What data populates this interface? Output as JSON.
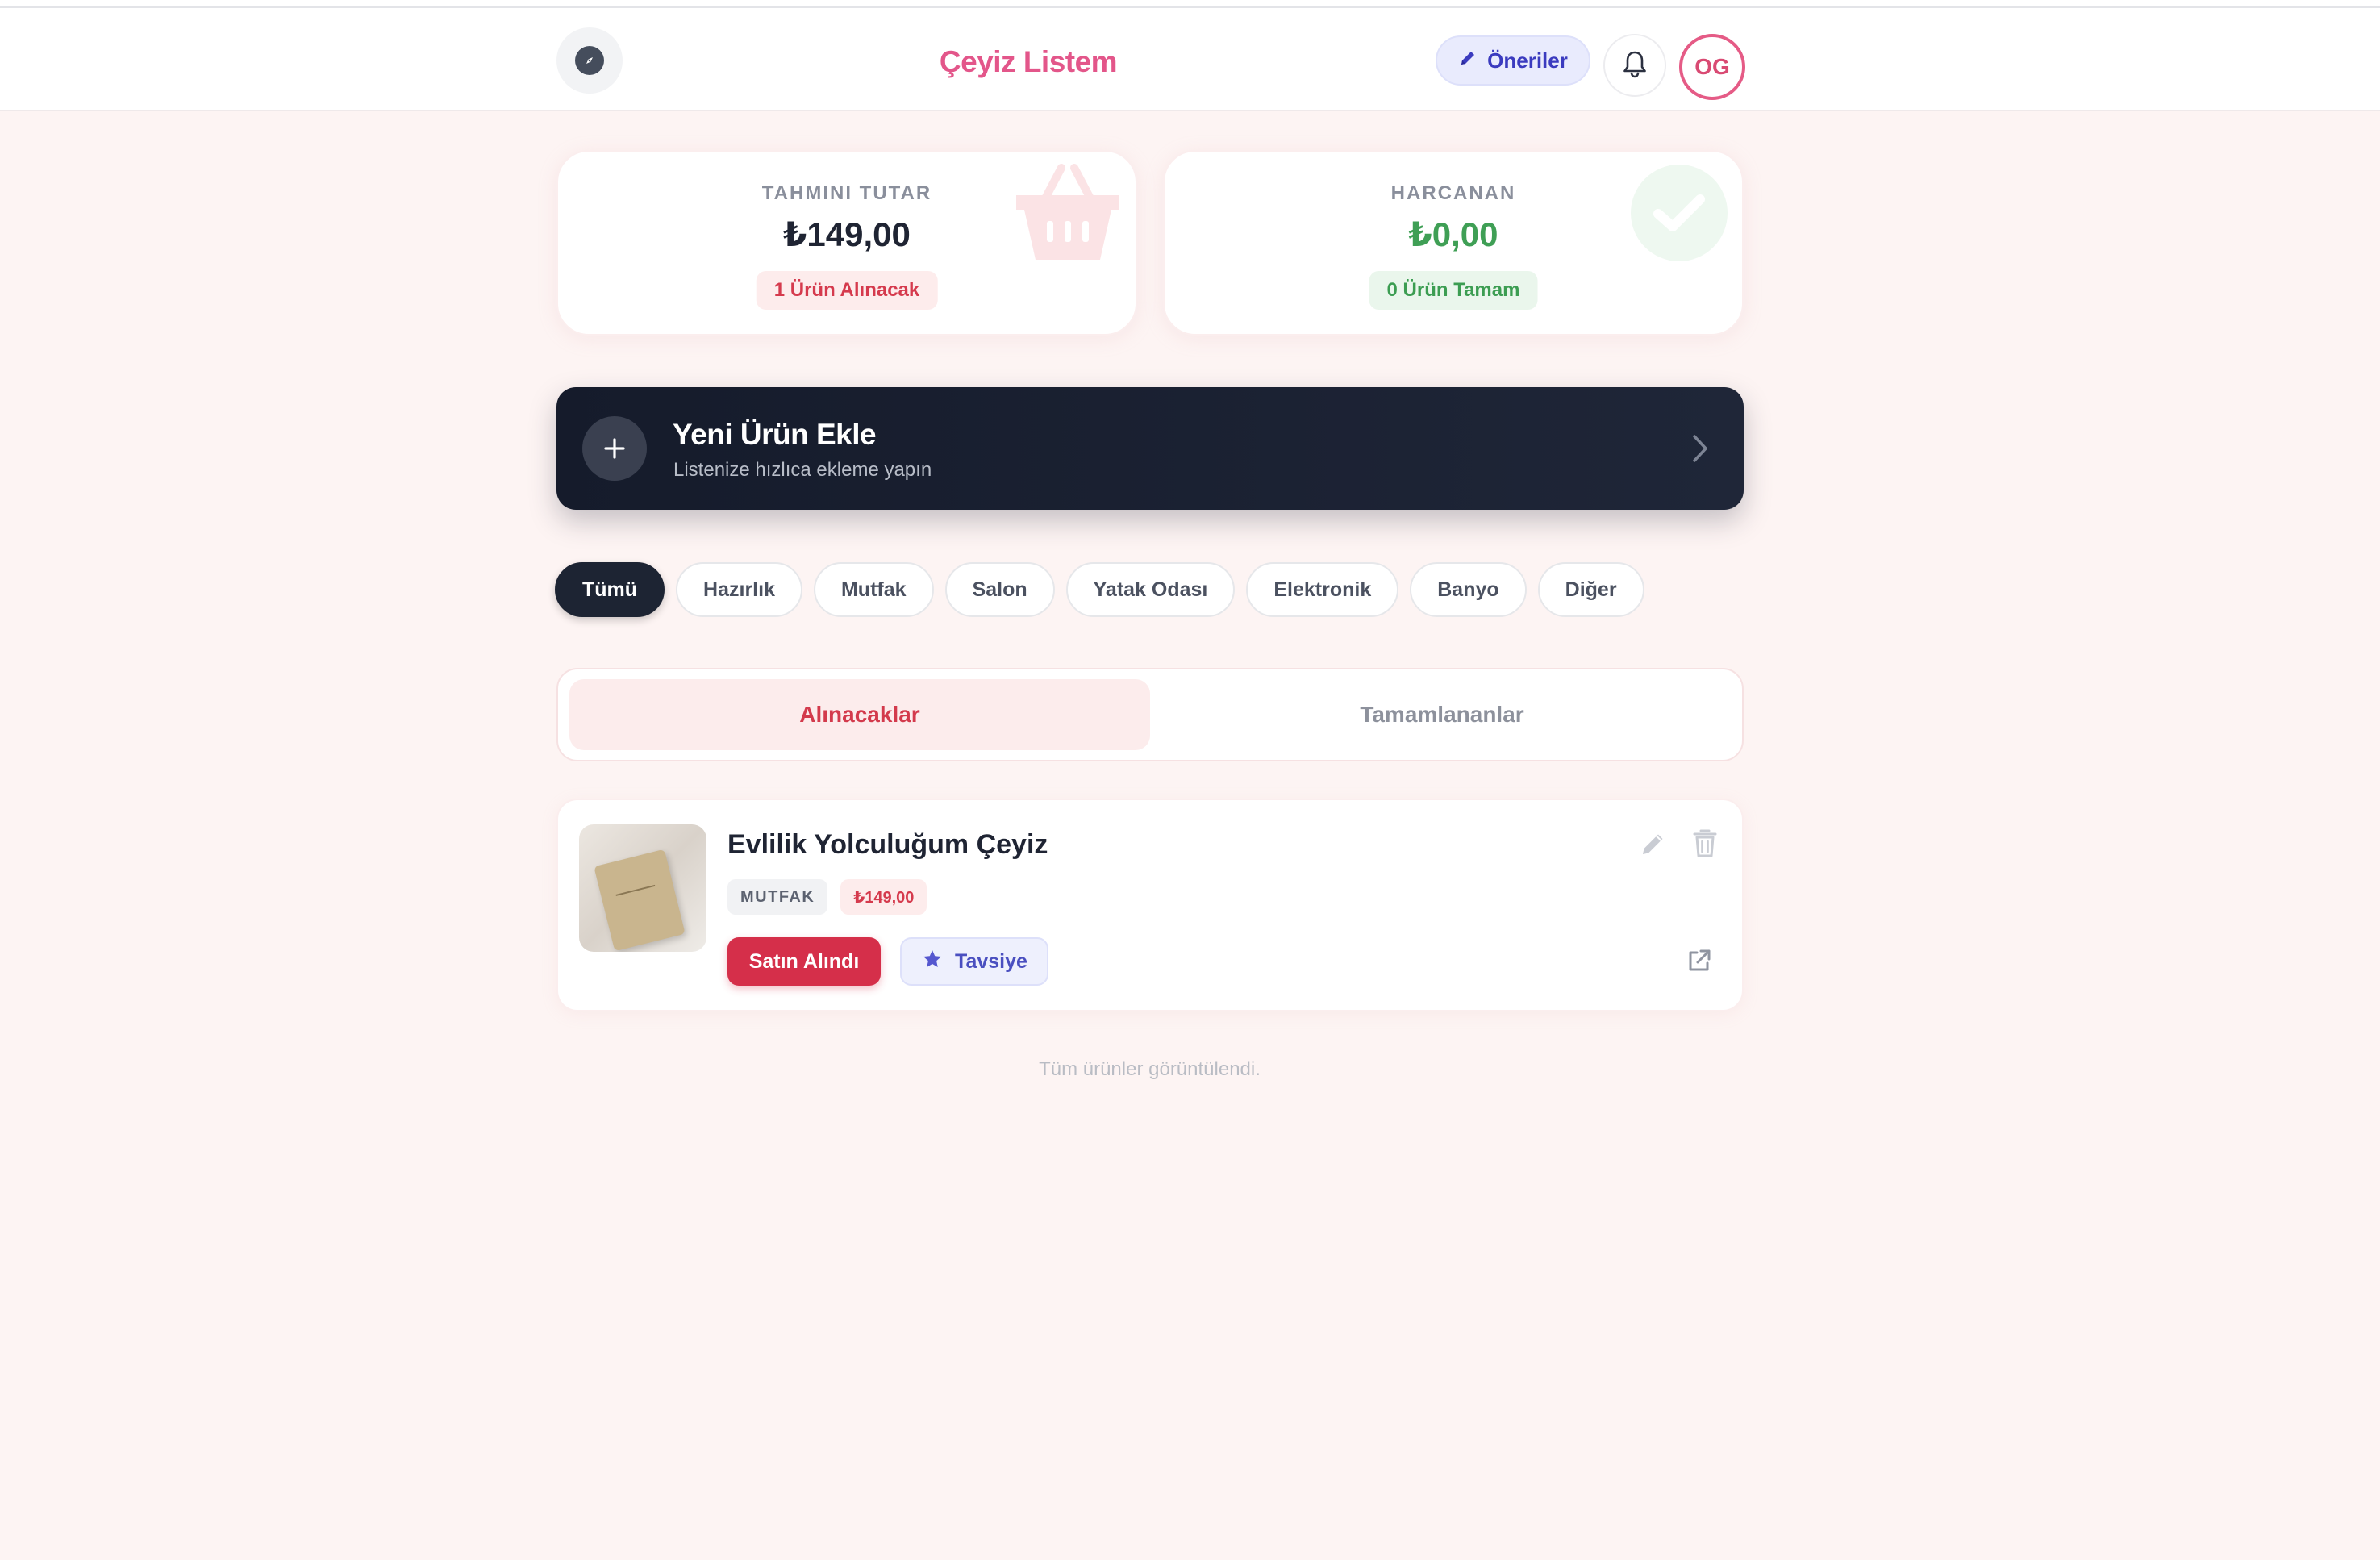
{
  "header": {
    "title": "Çeyiz Listem",
    "suggestions_label": "Öneriler",
    "avatar_initials": "OG",
    "icons": [
      "compass-icon",
      "pencil-icon",
      "bell-icon"
    ]
  },
  "stats": {
    "estimated": {
      "label": "TAHMINI TUTAR",
      "amount": "₺149,00",
      "badge": "1 Ürün Alınacak",
      "icon": "basket-icon"
    },
    "spent": {
      "label": "HARCANAN",
      "amount": "₺0,00",
      "badge": "0 Ürün Tamam",
      "icon": "check-icon"
    }
  },
  "add_product": {
    "title": "Yeni Ürün Ekle",
    "subtitle": "Listenize hızlıca ekleme yapın"
  },
  "categories": [
    "Tümü",
    "Hazırlık",
    "Mutfak",
    "Salon",
    "Yatak Odası",
    "Elektronik",
    "Banyo",
    "Diğer"
  ],
  "active_category": "Tümü",
  "tabs": [
    "Alınacaklar",
    "Tamamlananlar"
  ],
  "active_tab": "Alınacaklar",
  "products": [
    {
      "title": "Evlilik Yolculuğum Çeyiz",
      "category": "MUTFAK",
      "price": "₺149,00",
      "bought_label": "Satın Alındı",
      "advice_label": "Tavsiye"
    }
  ],
  "footer_note": "Tüm ürünler görüntülendi.",
  "colors": {
    "brand_pink": "#e3568a",
    "danger": "#d52f4a",
    "success": "#3f9f55",
    "dark": "#1d2433",
    "indigo": "#4a4fc0",
    "background": "#fdf4f3"
  }
}
